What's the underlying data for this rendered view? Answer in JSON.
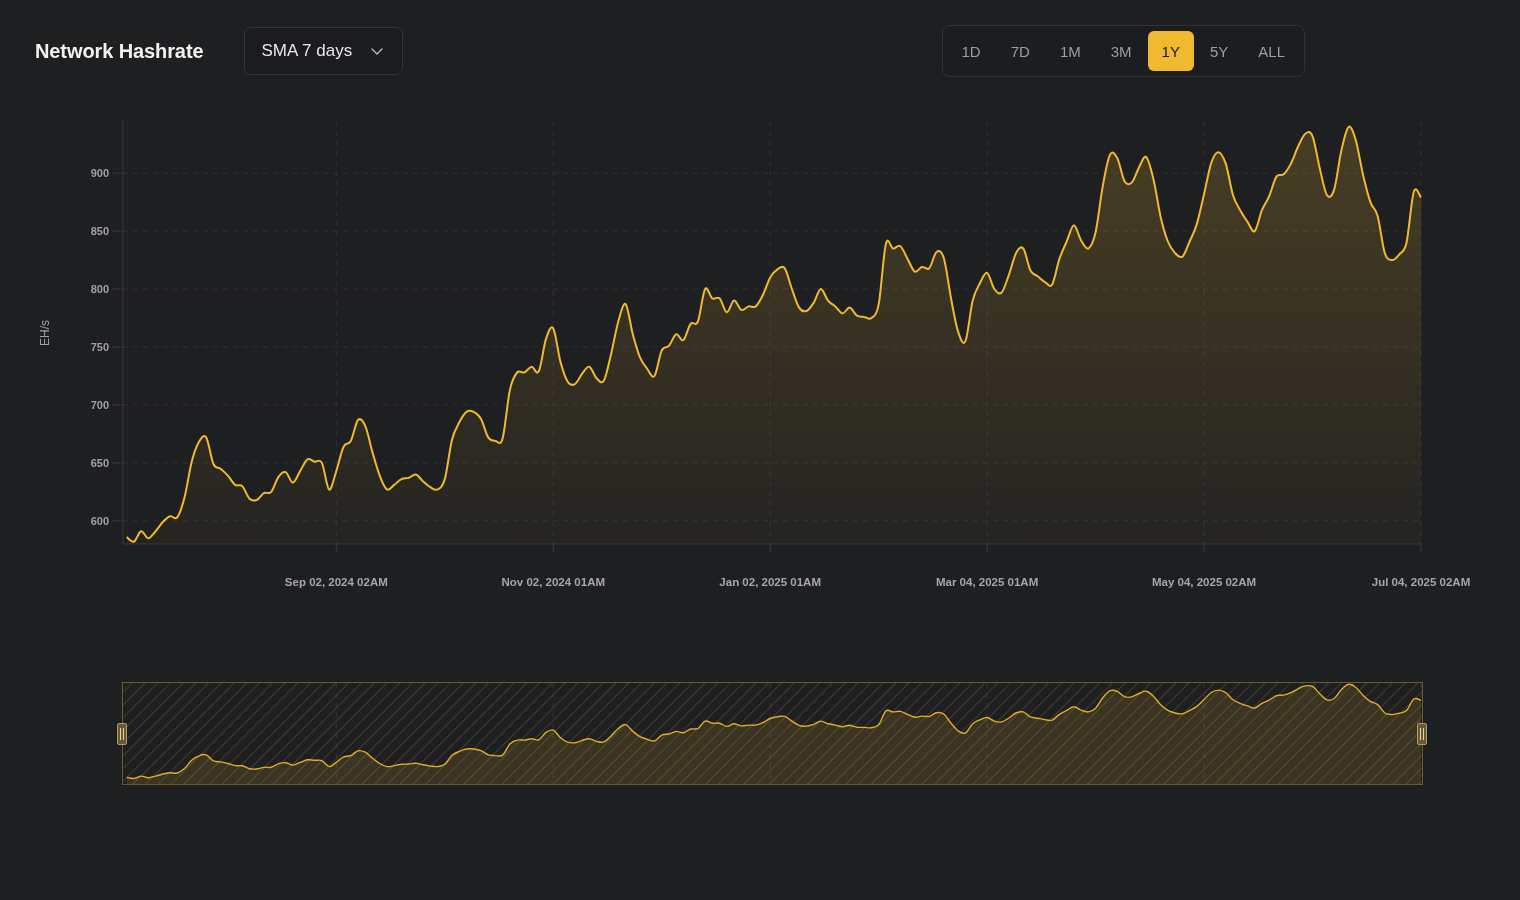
{
  "header": {
    "title": "Network Hashrate",
    "smoothing": {
      "value": "SMA 7 days"
    }
  },
  "range_buttons": [
    {
      "label": "1D",
      "selected": false
    },
    {
      "label": "7D",
      "selected": false
    },
    {
      "label": "1M",
      "selected": false
    },
    {
      "label": "3M",
      "selected": false
    },
    {
      "label": "1Y",
      "selected": true
    },
    {
      "label": "5Y",
      "selected": false
    },
    {
      "label": "ALL",
      "selected": false
    }
  ],
  "chart": {
    "chart_data": {
      "type": "area",
      "grid": true,
      "ylabel": "EH/s",
      "ylim": [
        580,
        945
      ],
      "yticks": [
        600,
        650,
        700,
        750,
        800,
        850,
        900
      ],
      "categories": [
        null,
        null,
        null,
        null,
        null,
        null,
        null,
        null,
        null,
        null,
        null,
        null,
        null,
        null,
        null,
        null,
        null,
        null,
        null,
        null,
        null,
        null,
        null,
        null,
        null,
        null,
        null,
        null,
        null,
        "Sep 02, 2024 02AM",
        null,
        null,
        null,
        null,
        null,
        null,
        null,
        null,
        null,
        null,
        null,
        null,
        null,
        null,
        null,
        null,
        null,
        null,
        null,
        null,
        null,
        null,
        null,
        null,
        null,
        null,
        null,
        null,
        null,
        "Nov 02, 2024 01AM",
        null,
        null,
        null,
        null,
        null,
        null,
        null,
        null,
        null,
        null,
        null,
        null,
        null,
        null,
        null,
        null,
        null,
        null,
        null,
        null,
        null,
        null,
        null,
        null,
        null,
        null,
        null,
        null,
        null,
        "Jan 02, 2025 01AM",
        null,
        null,
        null,
        null,
        null,
        null,
        null,
        null,
        null,
        null,
        null,
        null,
        null,
        null,
        null,
        null,
        null,
        null,
        null,
        null,
        null,
        null,
        null,
        null,
        null,
        null,
        null,
        null,
        null,
        "Mar 04, 2025 01AM",
        null,
        null,
        null,
        null,
        null,
        null,
        null,
        null,
        null,
        null,
        null,
        null,
        null,
        null,
        null,
        null,
        null,
        null,
        null,
        null,
        null,
        null,
        null,
        null,
        null,
        null,
        null,
        null,
        null,
        "May 04, 2025 02AM",
        null,
        null,
        null,
        null,
        null,
        null,
        null,
        null,
        null,
        null,
        null,
        null,
        null,
        null,
        null,
        null,
        null,
        null,
        null,
        null,
        null,
        null,
        null,
        null,
        null,
        null,
        null,
        null,
        null,
        "Jul 04, 2025 02AM"
      ],
      "values": [
        586,
        582,
        591,
        585,
        591,
        599,
        604,
        603,
        620,
        651,
        668,
        672,
        649,
        645,
        639,
        631,
        630,
        619,
        618,
        624,
        625,
        638,
        642,
        633,
        643,
        653,
        651,
        650,
        627,
        643,
        664,
        669,
        687,
        682,
        659,
        639,
        627,
        631,
        636,
        637,
        640,
        634,
        629,
        627,
        636,
        670,
        685,
        694,
        694,
        688,
        672,
        669,
        671,
        713,
        728,
        728,
        733,
        729,
        757,
        766,
        737,
        720,
        718,
        727,
        733,
        723,
        721,
        744,
        772,
        787,
        761,
        741,
        731,
        725,
        747,
        751,
        761,
        756,
        770,
        772,
        800,
        792,
        792,
        780,
        790,
        782,
        785,
        785,
        795,
        810,
        817,
        818,
        800,
        784,
        781,
        788,
        800,
        790,
        785,
        779,
        784,
        777,
        776,
        775,
        787,
        839,
        835,
        837,
        826,
        815,
        819,
        818,
        832,
        827,
        792,
        763,
        755,
        790,
        805,
        814,
        800,
        797,
        812,
        831,
        835,
        816,
        811,
        806,
        804,
        826,
        841,
        855,
        842,
        835,
        849,
        889,
        916,
        913,
        893,
        892,
        905,
        914,
        895,
        862,
        841,
        831,
        828,
        841,
        856,
        882,
        909,
        918,
        908,
        881,
        868,
        858,
        850,
        868,
        880,
        897,
        899,
        908,
        923,
        934,
        932,
        904,
        881,
        886,
        920,
        940,
        928,
        898,
        875,
        863,
        831,
        825,
        830,
        840,
        884,
        879
      ]
    }
  }
}
